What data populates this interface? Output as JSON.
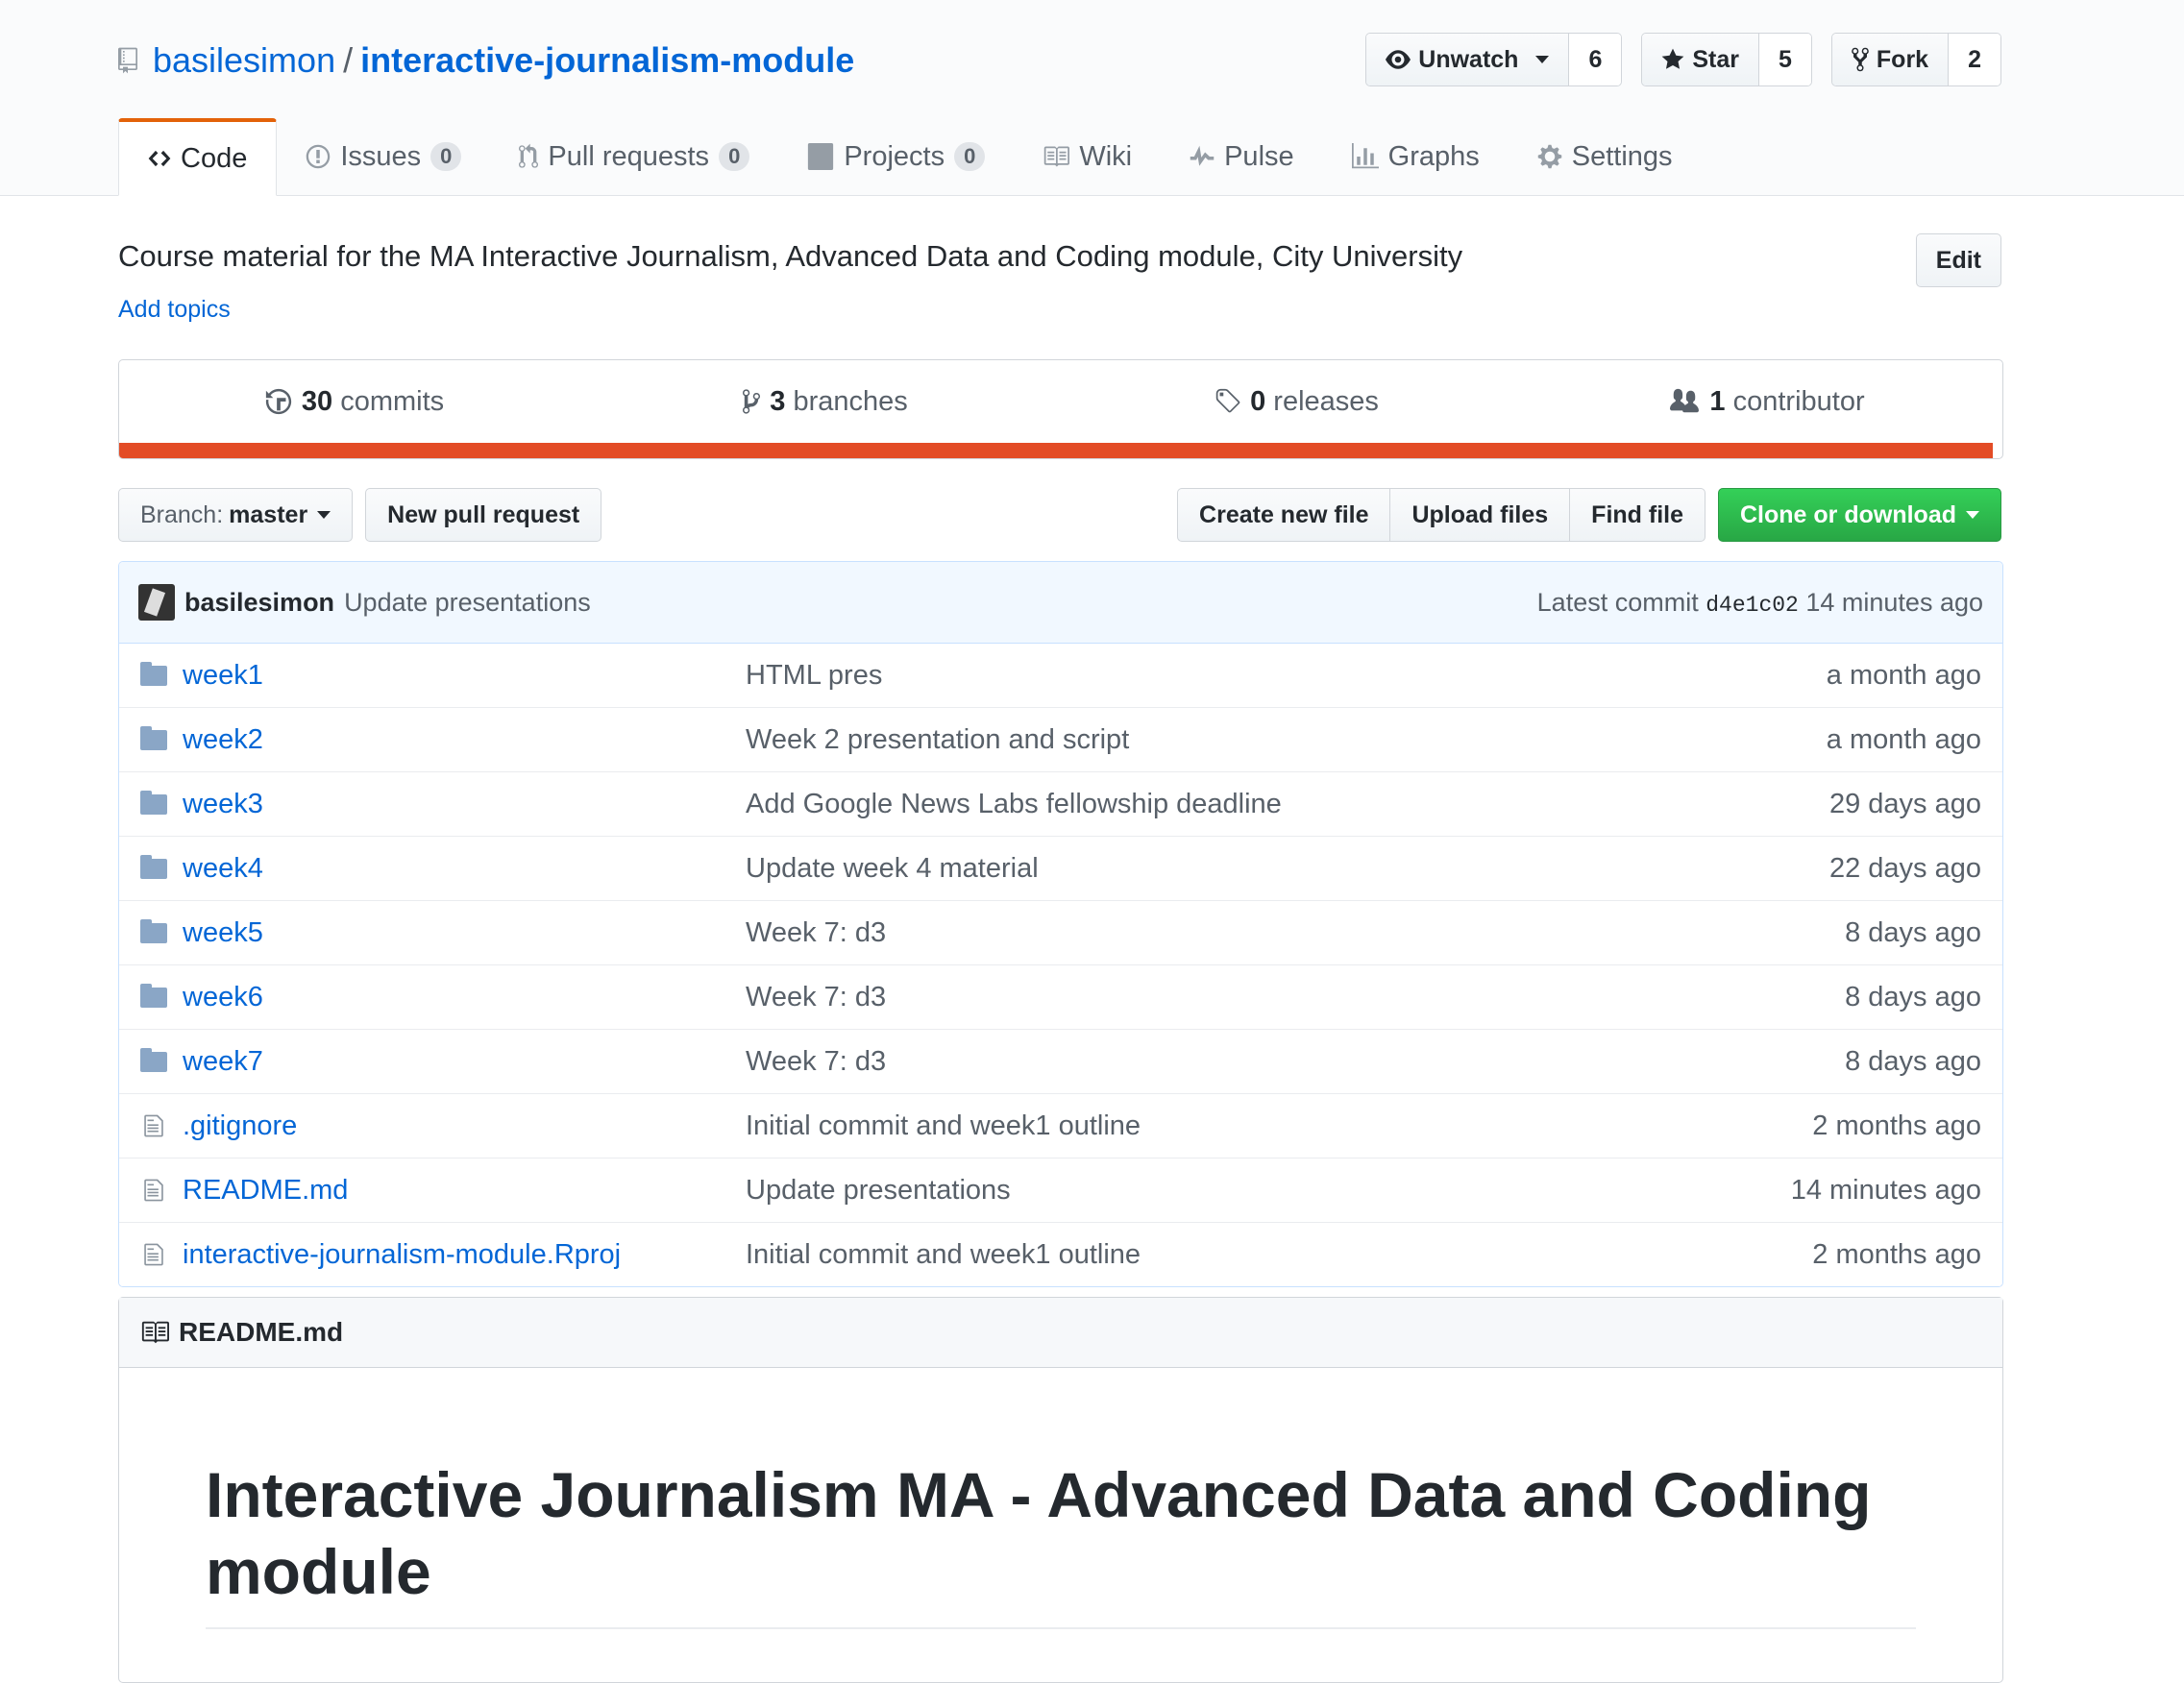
{
  "repo": {
    "owner": "basilesimon",
    "separator": "/",
    "name": "interactive-journalism-module"
  },
  "actions": {
    "watch": {
      "label": "Unwatch",
      "count": "6"
    },
    "star": {
      "label": "Star",
      "count": "5"
    },
    "fork": {
      "label": "Fork",
      "count": "2"
    }
  },
  "tabs": [
    {
      "label": "Code",
      "icon": "code-icon"
    },
    {
      "label": "Issues",
      "count": "0",
      "icon": "issue-icon"
    },
    {
      "label": "Pull requests",
      "count": "0",
      "icon": "pull-request-icon"
    },
    {
      "label": "Projects",
      "count": "0",
      "icon": "project-icon"
    },
    {
      "label": "Wiki",
      "icon": "book-icon"
    },
    {
      "label": "Pulse",
      "icon": "pulse-icon"
    },
    {
      "label": "Graphs",
      "icon": "graph-icon"
    },
    {
      "label": "Settings",
      "icon": "gear-icon"
    }
  ],
  "description": "Course material for the MA Interactive Journalism, Advanced Data and Coding module, City University",
  "edit_label": "Edit",
  "add_topics": "Add topics",
  "summary": {
    "commits": {
      "count": "30",
      "label": "commits"
    },
    "branches": {
      "count": "3",
      "label": "branches"
    },
    "releases": {
      "count": "0",
      "label": "releases"
    },
    "contributors": {
      "count": "1",
      "label": "contributor"
    }
  },
  "language_color": "#e34c26",
  "toolbar": {
    "branch_prefix": "Branch:",
    "branch": "master",
    "new_pr": "New pull request",
    "create_file": "Create new file",
    "upload": "Upload files",
    "find": "Find file",
    "clone": "Clone or download"
  },
  "latest_commit": {
    "author": "basilesimon",
    "message": "Update presentations",
    "prefix": "Latest commit",
    "sha": "d4e1c02",
    "age": "14 minutes ago"
  },
  "files": [
    {
      "type": "dir",
      "name": "week1",
      "message": "HTML pres",
      "age": "a month ago"
    },
    {
      "type": "dir",
      "name": "week2",
      "message": "Week 2 presentation and script",
      "age": "a month ago"
    },
    {
      "type": "dir",
      "name": "week3",
      "message": "Add Google News Labs fellowship deadline",
      "age": "29 days ago"
    },
    {
      "type": "dir",
      "name": "week4",
      "message": "Update week 4 material",
      "age": "22 days ago"
    },
    {
      "type": "dir",
      "name": "week5",
      "message": "Week 7: d3",
      "age": "8 days ago"
    },
    {
      "type": "dir",
      "name": "week6",
      "message": "Week 7: d3",
      "age": "8 days ago"
    },
    {
      "type": "dir",
      "name": "week7",
      "message": "Week 7: d3",
      "age": "8 days ago"
    },
    {
      "type": "file",
      "name": ".gitignore",
      "message": "Initial commit and week1 outline",
      "age": "2 months ago"
    },
    {
      "type": "file",
      "name": "README.md",
      "message": "Update presentations",
      "age": "14 minutes ago"
    },
    {
      "type": "file",
      "name": "interactive-journalism-module.Rproj",
      "message": "Initial commit and week1 outline",
      "age": "2 months ago"
    }
  ],
  "readme": {
    "filename": "README.md",
    "heading": "Interactive Journalism MA - Advanced Data and Coding module"
  }
}
